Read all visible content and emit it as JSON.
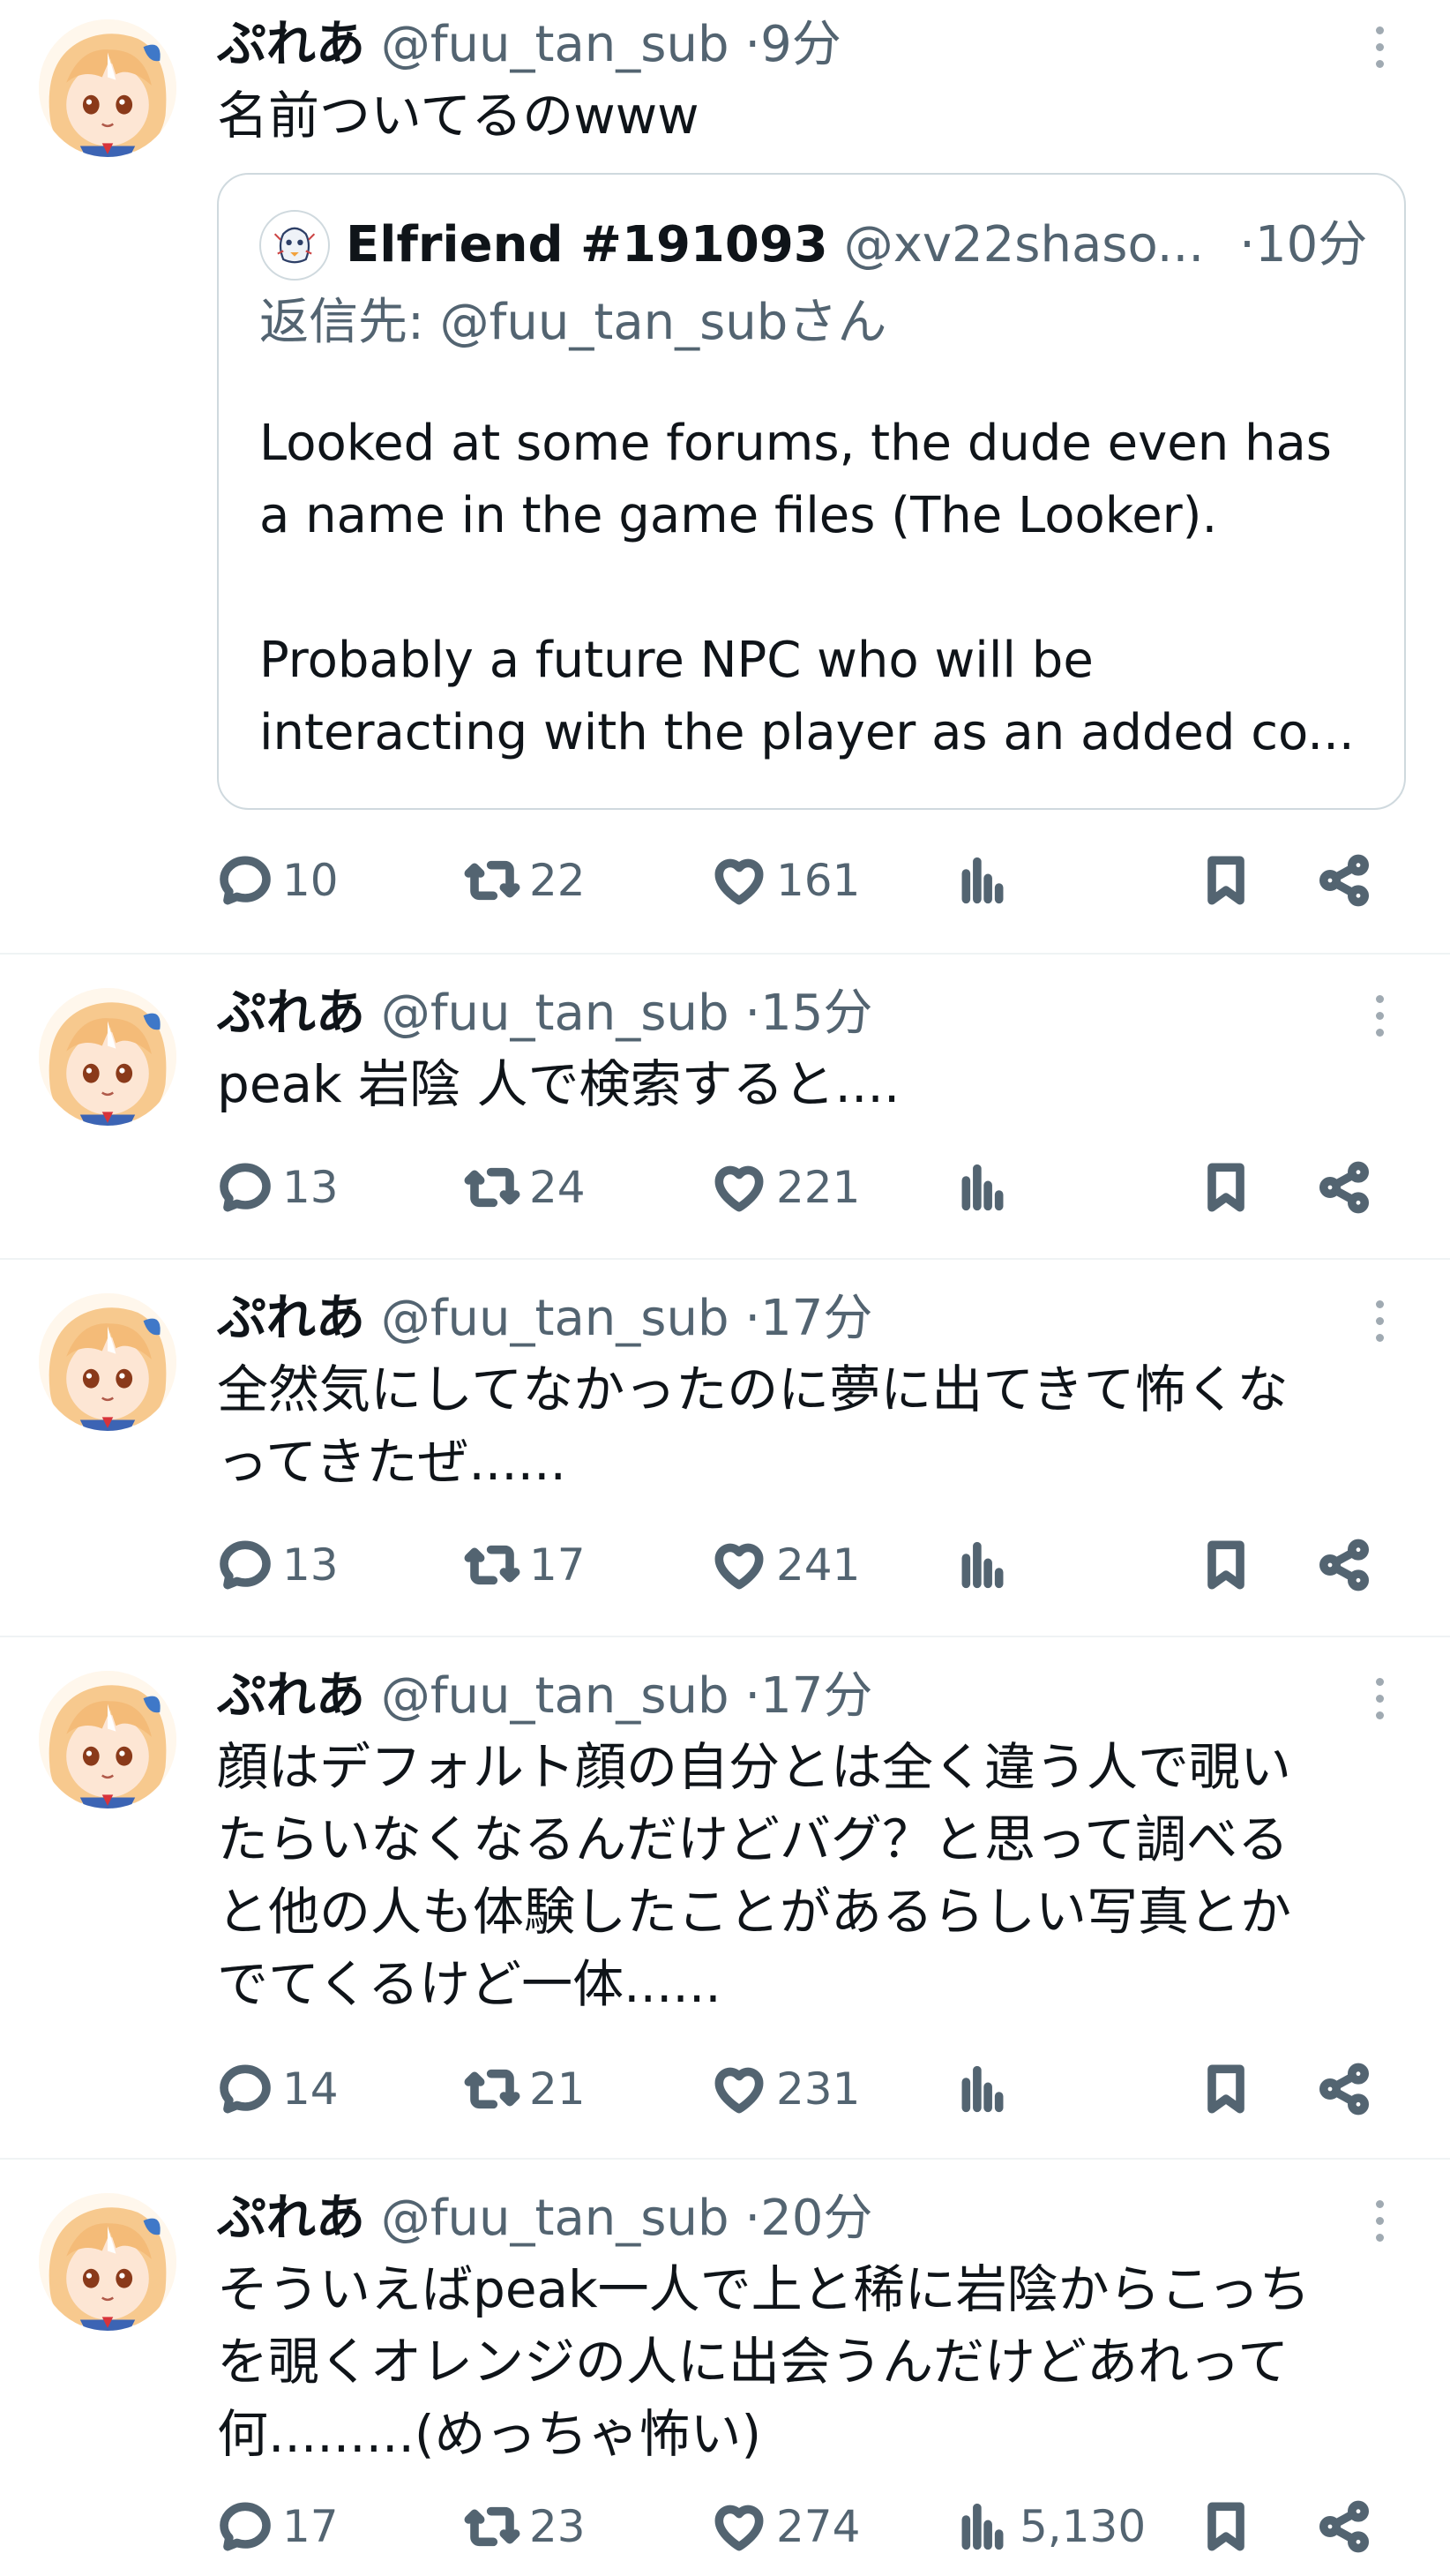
{
  "user": {
    "display_name": "ぷれあ",
    "handle": "@fuu_tan_sub"
  },
  "tweets": [
    {
      "time": "9分",
      "text": "名前ついてるのwww",
      "quote": {
        "name": "Elfriend #191093",
        "handle": "@xv22shaso...",
        "time": "10分",
        "reply_to": "返信先: @fuu_tan_subさん",
        "text": "Looked at some forums, the dude even has\na name in the game files (The Looker).\n\nProbably a future NPC who will be\ninteracting with the player as an added co..."
      },
      "replies": "10",
      "reposts": "22",
      "likes": "161",
      "views": ""
    },
    {
      "time": "15分",
      "text": "peak 岩陰 人で検索すると....",
      "replies": "13",
      "reposts": "24",
      "likes": "221",
      "views": ""
    },
    {
      "time": "17分",
      "text": "全然気にしてなかったのに夢に出てきて怖くな\nってきたぜ......",
      "replies": "13",
      "reposts": "17",
      "likes": "241",
      "views": ""
    },
    {
      "time": "17分",
      "text": "顔はデフォルト顔の自分とは全く違う人で覗い\nたらいなくなるんだけどバグ？と思って調べる\nと他の人も体験したことがあるらしい写真とか\nでてくるけど一体......",
      "replies": "14",
      "reposts": "21",
      "likes": "231",
      "views": ""
    },
    {
      "time": "20分",
      "text": "そういえばpeak一人で上と稀に岩陰からこっち\nを覗くオレンジの人に出会うんだけどあれって\n何.........(めっちゃ怖い)",
      "replies": "17",
      "reposts": "23",
      "likes": "274",
      "views": "5,130"
    }
  ],
  "icons": {
    "reply": "speech-bubble-icon",
    "repost": "repost-arrows-icon",
    "like": "heart-icon",
    "views": "bar-chart-icon",
    "bookmark": "bookmark-icon",
    "share": "share-nodes-icon",
    "more": "more-vertical-icon"
  },
  "colors": {
    "text": "#0f1419",
    "secondary": "#536471",
    "border": "#cfd9de",
    "avatar_hair": "#f7c98e"
  }
}
